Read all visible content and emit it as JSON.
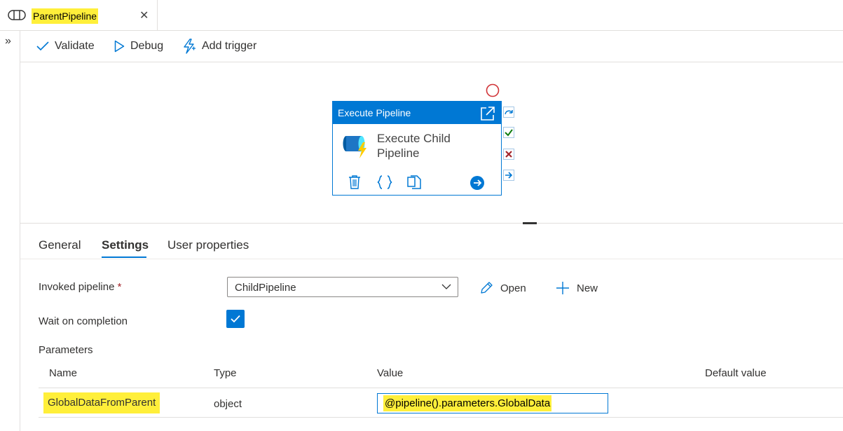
{
  "tab": {
    "title": "ParentPipeline",
    "close": "✕"
  },
  "rail": {
    "toggle": "»"
  },
  "toolbar": {
    "validate": "Validate",
    "debug": "Debug",
    "add_trigger": "Add trigger"
  },
  "activity": {
    "type": "Execute Pipeline",
    "name_line1": "Execute Child",
    "name_line2": "Pipeline"
  },
  "panel_tabs": [
    {
      "label": "General"
    },
    {
      "label": "Settings",
      "active": true
    },
    {
      "label": "User properties"
    }
  ],
  "settings": {
    "invoked_pipeline_label": "Invoked pipeline",
    "required_marker": "*",
    "invoked_pipeline_value": "ChildPipeline",
    "open_label": "Open",
    "new_label": "New",
    "wait_label": "Wait on completion",
    "wait_checked": true
  },
  "parameters": {
    "section_title": "Parameters",
    "headers": {
      "name": "Name",
      "type": "Type",
      "value": "Value",
      "default": "Default value"
    },
    "rows": [
      {
        "name": "GlobalDataFromParent",
        "type": "object",
        "value": "@pipeline().parameters.GlobalData"
      }
    ]
  },
  "colors": {
    "accent": "#0078d4",
    "highlight": "#ffef3a",
    "success": "#107c10",
    "failure": "#a4262c"
  }
}
